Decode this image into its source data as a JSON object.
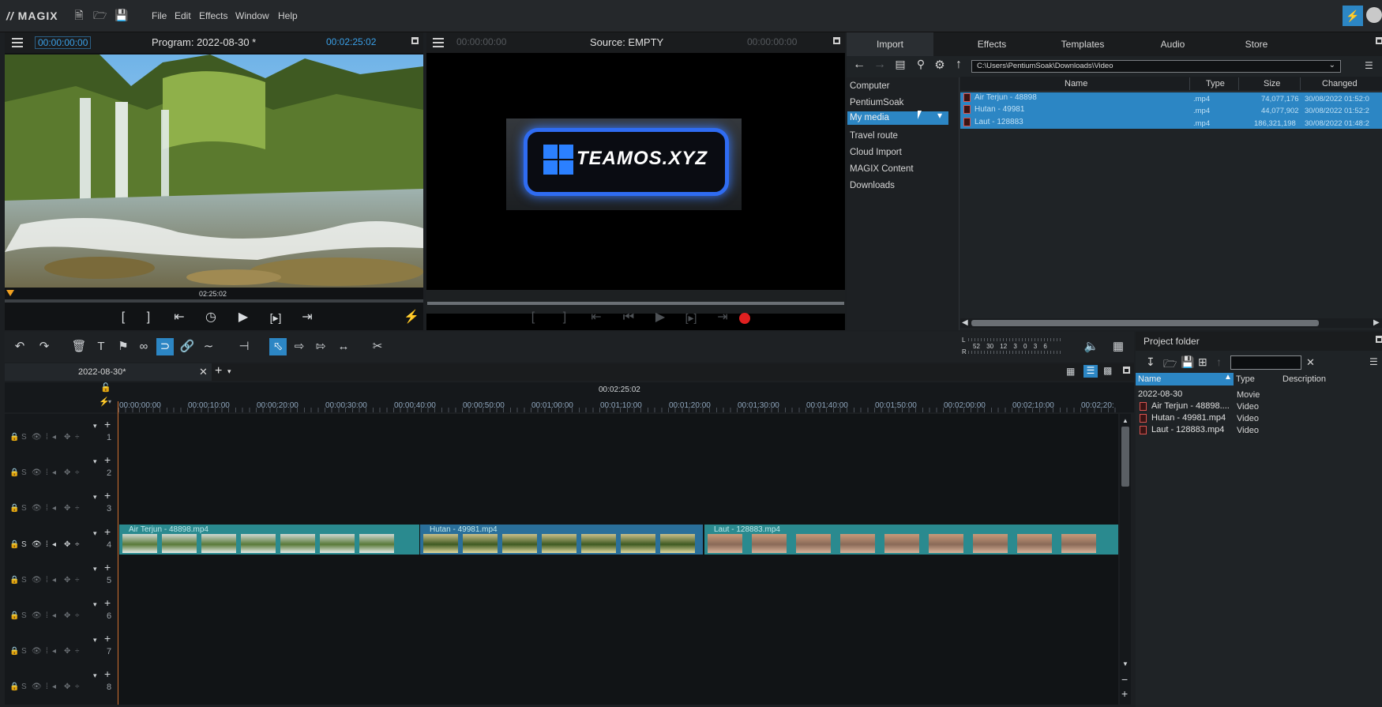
{
  "menubar": {
    "logo": "MAGIX",
    "items": [
      "File",
      "Edit",
      "Effects",
      "Window",
      "Help"
    ]
  },
  "program_monitor": {
    "timecode_left": "00:00:00:00",
    "title": "Program: 2022-08-30 *",
    "timecode_right": "00:02:25:02",
    "scrub_label": "02:25:02"
  },
  "source_monitor": {
    "timecode_left": "00:00:00:00",
    "title": "Source: EMPTY",
    "timecode_right": "00:00:00:00",
    "watermark": "TEAMOS.XYZ"
  },
  "import_panel": {
    "tabs": [
      "Import",
      "Effects",
      "Templates",
      "Audio",
      "Store"
    ],
    "path": "C:\\Users\\PentiumSoak\\Downloads\\Video",
    "nav": [
      "Computer",
      "PentiumSoak",
      "My media",
      "Travel route",
      "Cloud Import",
      "MAGIX Content",
      "Downloads"
    ],
    "columns": [
      "Name",
      "Type",
      "Size",
      "Changed"
    ],
    "files": [
      {
        "name": "Air Terjun - 48898",
        "type": ".mp4",
        "size": "74,077,176",
        "changed": "30/08/2022 01:52:0"
      },
      {
        "name": "Hutan - 49981",
        "type": ".mp4",
        "size": "44,077,902",
        "changed": "30/08/2022 01:52:2"
      },
      {
        "name": "Laut - 128883",
        "type": ".mp4",
        "size": "186,321,198",
        "changed": "30/08/2022 01:48:2"
      }
    ]
  },
  "meter": {
    "L": "L",
    "R": "R",
    "scale": "52 30 12 3 0 3 6"
  },
  "timeline": {
    "tab": "2022-08-30*",
    "playhead": "00:02:25:02",
    "ruler": [
      "00:00:00:00",
      "00:00:10:00",
      "00:00:20:00",
      "00:00:30:00",
      "00:00:40:00",
      "00:00:50:00",
      "00:01:00:00",
      "00:01:10:00",
      "00:01:20:00",
      "00:01:30:00",
      "00:01:40:00",
      "00:01:50:00",
      "00:02:00:00",
      "00:02:10:00",
      "00:02:20:"
    ],
    "tracks": [
      "1",
      "2",
      "3",
      "4",
      "5",
      "6",
      "7",
      "8"
    ],
    "clips": [
      {
        "label": "Air Terjun - 48898.mp4",
        "color": "#2a8a8f"
      },
      {
        "label": "Hutan - 49981.mp4",
        "color": "#2a6f9a"
      },
      {
        "label": "Laut - 128883.mp4",
        "color": "#2a8a8f"
      }
    ]
  },
  "project_folder": {
    "title": "Project folder",
    "columns": [
      "Name",
      "Type",
      "Description"
    ],
    "rows": [
      {
        "name": "2022-08-30",
        "type": "Movie",
        "icon": false
      },
      {
        "name": "Air Terjun - 48898....",
        "type": "Video",
        "icon": true
      },
      {
        "name": "Hutan - 49981.mp4",
        "type": "Video",
        "icon": true
      },
      {
        "name": "Laut - 128883.mp4",
        "type": "Video",
        "icon": true
      }
    ]
  },
  "colors": {
    "accent": "#3aa0e8",
    "selection": "#2c86c4",
    "clip": "#2a8a8f",
    "record": "#e02020"
  }
}
